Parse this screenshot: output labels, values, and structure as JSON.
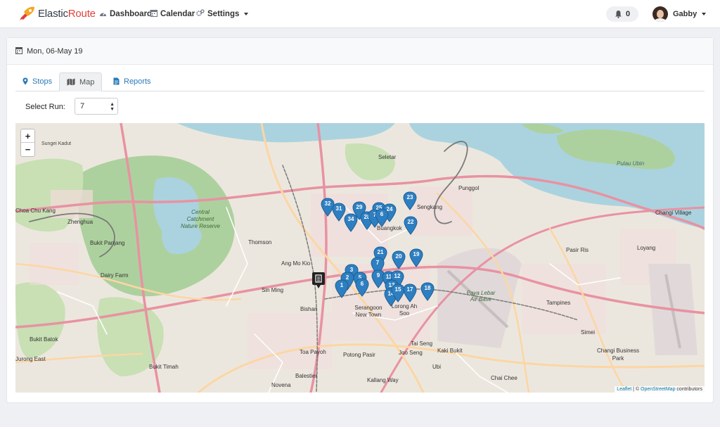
{
  "brand": {
    "part1": "Elastic",
    "part2": "Route"
  },
  "nav": {
    "dashboard": "Dashboard",
    "calendar": "Calendar",
    "settings": "Settings"
  },
  "notifications": {
    "count": "0"
  },
  "user": {
    "name": "Gabby"
  },
  "card": {
    "date": "Mon, 06-May 19"
  },
  "tabs": [
    {
      "label": "Stops"
    },
    {
      "label": "Map"
    },
    {
      "label": "Reports"
    }
  ],
  "run": {
    "label": "Select Run:",
    "selected": "7"
  },
  "map": {
    "zoom_in": "+",
    "zoom_out": "−",
    "attribution_leaflet": "Leaflet",
    "attribution_osm": "OpenStreetMap",
    "attribution_suffix": "contributors",
    "labels": [
      {
        "text": "Sungei Kadut"
      },
      {
        "text": "Choa Chu Kang"
      },
      {
        "text": "Zhenghua"
      },
      {
        "text": "Bukit Panjang"
      },
      {
        "text": "Dairy Farm"
      },
      {
        "text": "Bukit Batok"
      },
      {
        "text": "Jurong East"
      },
      {
        "text": "Bukit Timah"
      },
      {
        "text": "Central Catchment Nature Reserve"
      },
      {
        "text": "Thomson"
      },
      {
        "text": "Ang Mo Kio"
      },
      {
        "text": "Sin Ming"
      },
      {
        "text": "Bishan"
      },
      {
        "text": "Serangoon New Town"
      },
      {
        "text": "Lorong Ah Soo"
      },
      {
        "text": "Toa Payoh"
      },
      {
        "text": "Potong Pasir"
      },
      {
        "text": "Balestier"
      },
      {
        "text": "Novena"
      },
      {
        "text": "Kallang Way"
      },
      {
        "text": "Joo Seng"
      },
      {
        "text": "Ubi"
      },
      {
        "text": "Tai Seng"
      },
      {
        "text": "Kaki Bukit"
      },
      {
        "text": "Chai Chee"
      },
      {
        "text": "Seletar"
      },
      {
        "text": "Punggol"
      },
      {
        "text": "Sengkang"
      },
      {
        "text": "Buangkok"
      },
      {
        "text": "Pasir Ris"
      },
      {
        "text": "Loyang"
      },
      {
        "text": "Tampines"
      },
      {
        "text": "Simei"
      },
      {
        "text": "Changi Business Park"
      },
      {
        "text": "Changi Village"
      },
      {
        "text": "Pulau Ubin"
      },
      {
        "text": "Paya Lebar Air Base"
      }
    ],
    "markers": [
      {
        "label": "32"
      },
      {
        "label": "31"
      },
      {
        "label": "29"
      },
      {
        "label": "25"
      },
      {
        "label": "24"
      },
      {
        "label": "34"
      },
      {
        "label": "28"
      },
      {
        "label": "7"
      },
      {
        "label": "6"
      },
      {
        "label": "23"
      },
      {
        "label": "22"
      },
      {
        "label": "21"
      },
      {
        "label": "20"
      },
      {
        "label": "19"
      },
      {
        "label": "7"
      },
      {
        "label": "3"
      },
      {
        "label": "2"
      },
      {
        "label": "1"
      },
      {
        "label": "5"
      },
      {
        "label": "6"
      },
      {
        "label": "9"
      },
      {
        "label": "11"
      },
      {
        "label": "12"
      },
      {
        "label": "13"
      },
      {
        "label": "14"
      },
      {
        "label": "15"
      },
      {
        "label": "17"
      },
      {
        "label": "18"
      }
    ]
  }
}
